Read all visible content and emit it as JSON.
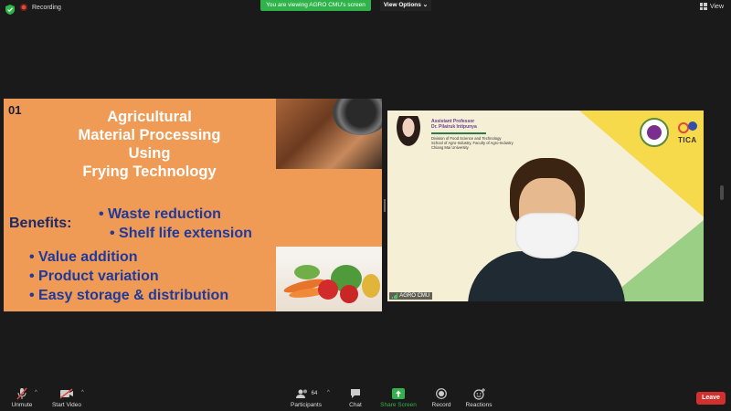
{
  "topbar": {
    "recording_label": "Recording",
    "viewing_banner": "You are viewing AGRO CMU's screen",
    "view_options_label": "View Options",
    "view_label": "View",
    "accent_green": "#2fb34a",
    "recording_color": "#e0483e"
  },
  "slide": {
    "number": "01",
    "title_lines": [
      "Agricultural",
      "Material Processing",
      "Using",
      "Frying Technology"
    ],
    "benefits_label": "Benefits:",
    "bullets_right": [
      "• Waste reduction",
      "• Shelf life extension"
    ],
    "bullets_left": [
      "• Value addition",
      "• Product variation",
      "• Easy storage & distribution"
    ],
    "background_color": "#ef9a55",
    "title_color": "#ffffff",
    "bullet_color": "#1f3a9c"
  },
  "video": {
    "presenter_title": "Assistant Professor",
    "presenter_name": "Dr. Pilairuk Intipunya",
    "presenter_info": [
      "Division of Food Science and Technology",
      "School of Agro-Industry, Faculty of Agro-Industry",
      "Chiang Mai University"
    ],
    "logo_text": "TICA",
    "participant_name": "AGRO CMU"
  },
  "toolbar": {
    "unmute": "Unmute",
    "start_video": "Start Video",
    "participants": "Participants",
    "participants_count": "64",
    "chat": "Chat",
    "share_screen": "Share Screen",
    "record": "Record",
    "reactions": "Reactions",
    "leave": "Leave",
    "leave_color": "#d0312d"
  }
}
